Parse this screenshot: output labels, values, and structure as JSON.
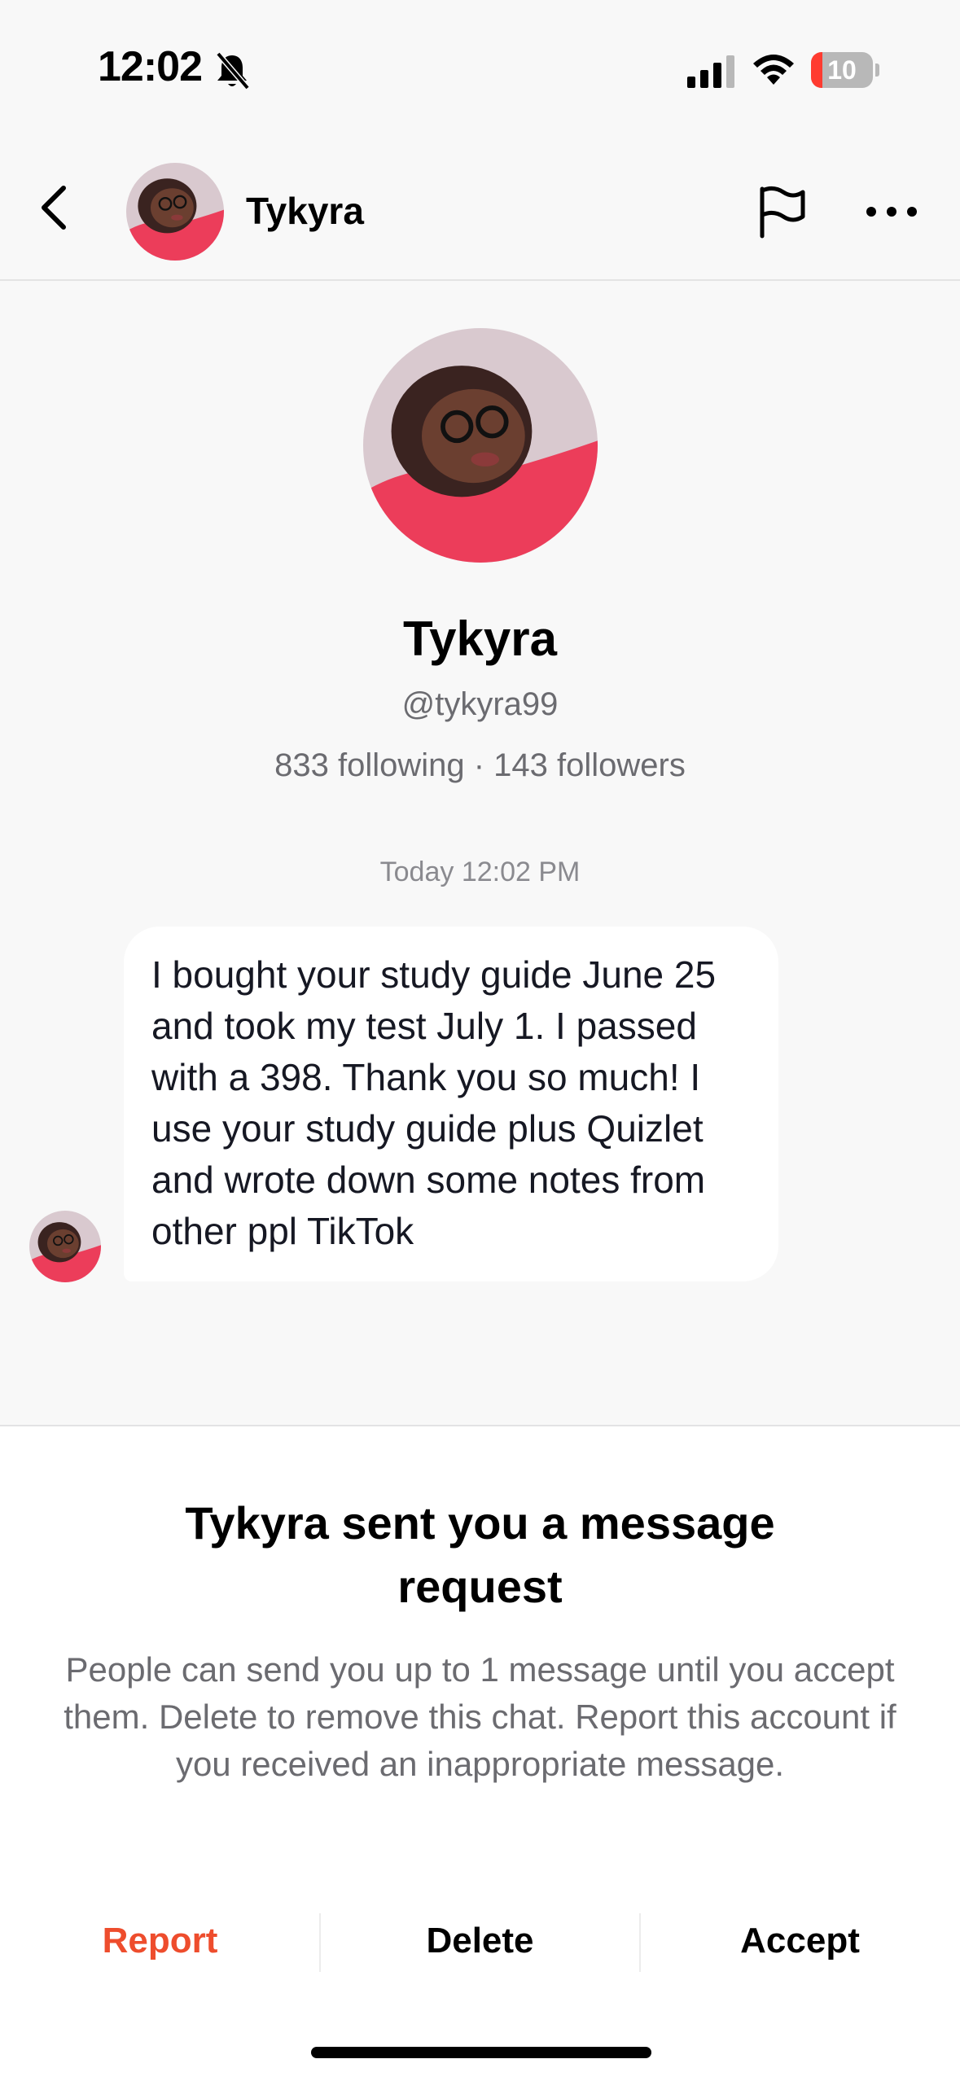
{
  "status_bar": {
    "time": "12:02",
    "battery_level": "10",
    "battery_percent": 10,
    "icons": [
      "bell-slash-icon",
      "signal-icon",
      "wifi-icon",
      "battery-icon"
    ]
  },
  "header": {
    "name": "Tykyra",
    "icons": [
      "back-icon",
      "flag-icon",
      "more-icon"
    ]
  },
  "profile": {
    "name": "Tykyra",
    "handle": "@tykyra99",
    "stats": "833 following · 143 followers"
  },
  "conversation": {
    "timestamp": "Today 12:02 PM",
    "message": "I bought your study guide June 25 and took my test July 1. I passed with a 398. Thank you so much! I use your study guide plus Quizlet and wrote down some notes from other ppl TikTok"
  },
  "request_sheet": {
    "title": "Tykyra sent you a message request",
    "description": "People can send you up to 1 message until you accept them. Delete to remove this chat. Report this account if you received an inappropriate message.",
    "report_label": "Report",
    "delete_label": "Delete",
    "accept_label": "Accept"
  },
  "colors": {
    "report": "#ee4d2d",
    "battery_low": "#ff3b30",
    "background": "#f8f8f8"
  }
}
